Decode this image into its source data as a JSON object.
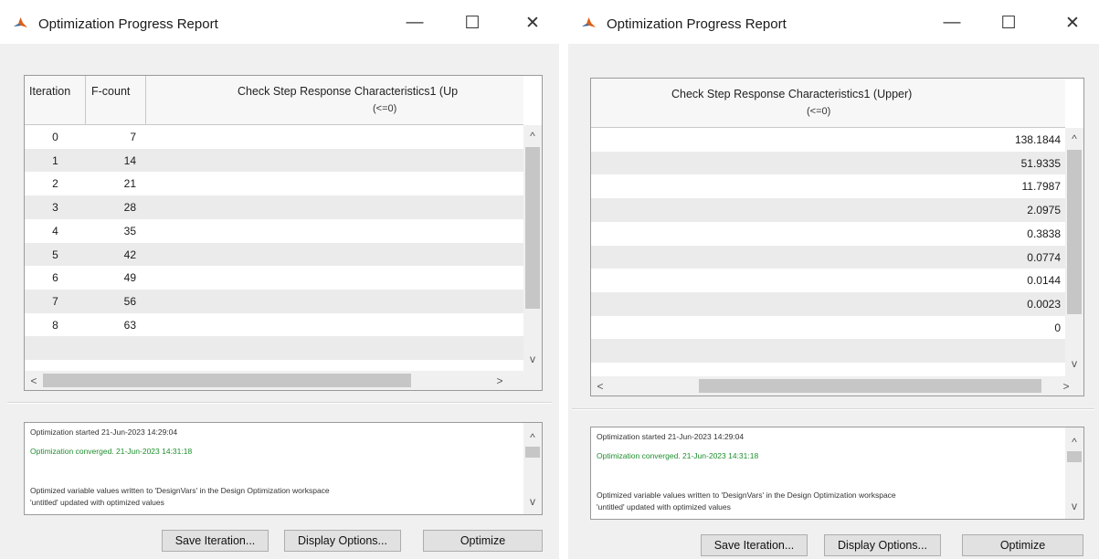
{
  "left_window": {
    "title": "Optimization Progress Report",
    "controls": {
      "minimize": "—",
      "maximize": "☐",
      "close": "✕"
    },
    "table": {
      "columns": {
        "iteration": "Iteration",
        "fcount": "F-count",
        "constraint": "Check Step Response  Characteristics1 (Up",
        "constraint_sub": "(<=0)"
      },
      "rows": [
        {
          "iteration": "0",
          "fcount": "7"
        },
        {
          "iteration": "1",
          "fcount": "14"
        },
        {
          "iteration": "2",
          "fcount": "21"
        },
        {
          "iteration": "3",
          "fcount": "28"
        },
        {
          "iteration": "4",
          "fcount": "35"
        },
        {
          "iteration": "5",
          "fcount": "42"
        },
        {
          "iteration": "6",
          "fcount": "49"
        },
        {
          "iteration": "7",
          "fcount": "56"
        },
        {
          "iteration": "8",
          "fcount": "63"
        }
      ]
    },
    "log": {
      "line1": "Optimization started 21-Jun-2023 14:29:04",
      "line2": "Optimization converged. 21-Jun-2023 14:31:18",
      "line3": "Optimized variable values written to 'DesignVars' in the Design Optimization workspace",
      "line4": "'untitled' updated with optimized values"
    },
    "buttons": {
      "save": "Save Iteration...",
      "display": "Display Options...",
      "optimize": "Optimize"
    }
  },
  "right_window": {
    "title": "Optimization Progress Report",
    "controls": {
      "minimize": "—",
      "maximize": "☐",
      "close": "✕"
    },
    "table": {
      "columns": {
        "constraint": "Check Step Response  Characteristics1 (Upper)",
        "constraint_sub": "(<=0)"
      },
      "rows": [
        {
          "value": "138.1844"
        },
        {
          "value": "51.9335"
        },
        {
          "value": "11.7987"
        },
        {
          "value": "2.0975"
        },
        {
          "value": "0.3838"
        },
        {
          "value": "0.0774"
        },
        {
          "value": "0.0144"
        },
        {
          "value": "0.0023"
        },
        {
          "value": "0"
        }
      ]
    },
    "log": {
      "line1": "Optimization started 21-Jun-2023 14:29:04",
      "line2": "Optimization converged. 21-Jun-2023 14:31:18",
      "line3": "Optimized variable values written to 'DesignVars' in the Design Optimization workspace",
      "line4": "'untitled' updated with optimized values"
    },
    "buttons": {
      "save": "Save Iteration...",
      "display": "Display Options...",
      "optimize": "Optimize"
    }
  },
  "scroll_arrows": {
    "up": "^",
    "down": "v",
    "left": "<",
    "right": ">"
  },
  "colors": {
    "converged_text": "#1f8f2e",
    "window_bg": "#f0f0f0",
    "row_alt": "#ebebeb"
  },
  "icons": {
    "app": "matlab-membrane-icon"
  }
}
